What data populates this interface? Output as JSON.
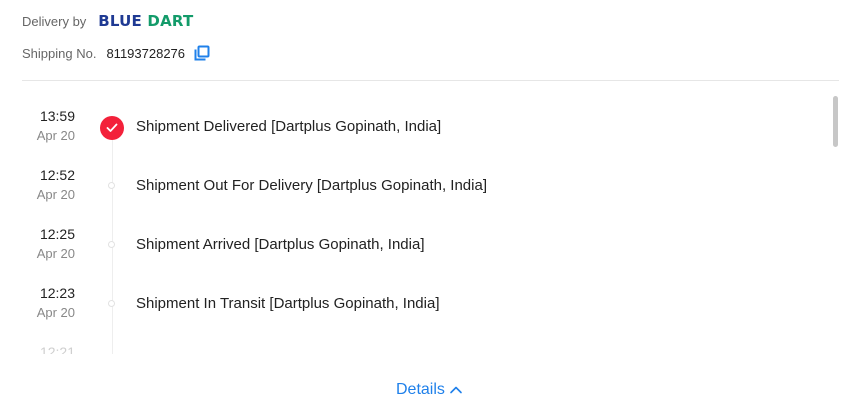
{
  "header": {
    "delivery_label": "Delivery by",
    "carrier": {
      "part1": "BLUE",
      "part2": "DART",
      "color_primary": "#1f3a93",
      "color_secondary": "#139b6a"
    },
    "shipping_label": "Shipping No.",
    "shipping_number": "81193728276",
    "copy_icon": "copy-icon"
  },
  "timeline": {
    "events": [
      {
        "time": "13:59",
        "date": "Apr 20",
        "text": "Shipment Delivered [Dartplus Gopinath, India]",
        "status": "delivered"
      },
      {
        "time": "12:52",
        "date": "Apr 20",
        "text": "Shipment Out For Delivery [Dartplus Gopinath, India]",
        "status": "past"
      },
      {
        "time": "12:25",
        "date": "Apr 20",
        "text": "Shipment Arrived [Dartplus Gopinath, India]",
        "status": "past"
      },
      {
        "time": "12:23",
        "date": "Apr 20",
        "text": "Shipment In Transit [Dartplus Gopinath, India]",
        "status": "past"
      },
      {
        "time": "12:21",
        "date": "",
        "text": "",
        "status": "past"
      }
    ],
    "accent_color": "#f3213a"
  },
  "footer": {
    "details_label": "Details",
    "details_icon": "chevron-up-icon",
    "link_color": "#1f80ea"
  }
}
